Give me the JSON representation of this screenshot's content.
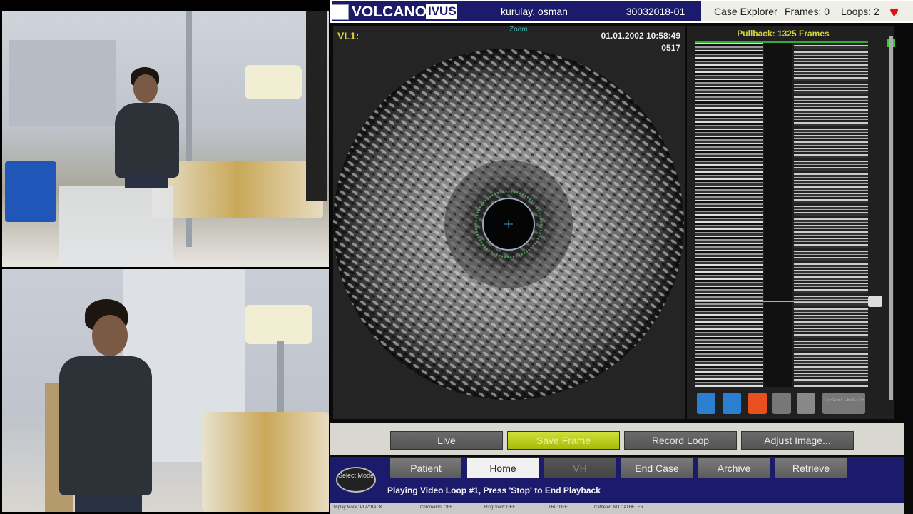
{
  "app": {
    "brand": "VOLCANO",
    "product": "IVUS",
    "patient_name": "kurulay, osman",
    "case_id": "30032018-01",
    "case_explorer": "Case Explorer",
    "frames": "Frames: 0",
    "loops": "Loops: 2"
  },
  "image": {
    "label": "VL1:",
    "zoom": "Zoom",
    "datetime": "01.01.2002 10:58:49",
    "frame_no": "0517"
  },
  "longview": {
    "pullback": "Pullback: 1325 Frames",
    "target_label": "TARGET LENGTH"
  },
  "buttons": {
    "live": "Live",
    "save_frame": "Save Frame",
    "record_loop": "Record Loop",
    "adjust_image": "Adjust Image..."
  },
  "tabs": [
    "Patient",
    "Home",
    "VH",
    "End Case",
    "Archive",
    "Retrieve"
  ],
  "mode_button": "Select Mode",
  "status": "Playing Video Loop #1, Press 'Stop' to End Playback",
  "footer": [
    "Display Mode: PLAYBACK",
    "ChromaFlo: OFF",
    "RingDown: OFF",
    "TRL: OFF",
    "Catheter: NO CATHETER"
  ],
  "colors": {
    "brand_blue": "#1c1a6b",
    "accent_yellow": "#d8d23a",
    "save_green": "#b5c91e"
  }
}
